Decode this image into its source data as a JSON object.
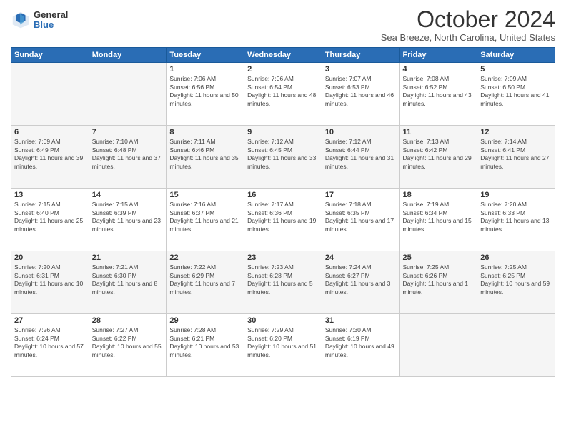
{
  "logo": {
    "general": "General",
    "blue": "Blue"
  },
  "title": "October 2024",
  "subtitle": "Sea Breeze, North Carolina, United States",
  "days_of_week": [
    "Sunday",
    "Monday",
    "Tuesday",
    "Wednesday",
    "Thursday",
    "Friday",
    "Saturday"
  ],
  "weeks": [
    [
      {
        "day": "",
        "empty": true
      },
      {
        "day": "",
        "empty": true
      },
      {
        "day": "1",
        "sunrise": "Sunrise: 7:06 AM",
        "sunset": "Sunset: 6:56 PM",
        "daylight": "Daylight: 11 hours and 50 minutes."
      },
      {
        "day": "2",
        "sunrise": "Sunrise: 7:06 AM",
        "sunset": "Sunset: 6:54 PM",
        "daylight": "Daylight: 11 hours and 48 minutes."
      },
      {
        "day": "3",
        "sunrise": "Sunrise: 7:07 AM",
        "sunset": "Sunset: 6:53 PM",
        "daylight": "Daylight: 11 hours and 46 minutes."
      },
      {
        "day": "4",
        "sunrise": "Sunrise: 7:08 AM",
        "sunset": "Sunset: 6:52 PM",
        "daylight": "Daylight: 11 hours and 43 minutes."
      },
      {
        "day": "5",
        "sunrise": "Sunrise: 7:09 AM",
        "sunset": "Sunset: 6:50 PM",
        "daylight": "Daylight: 11 hours and 41 minutes."
      }
    ],
    [
      {
        "day": "6",
        "sunrise": "Sunrise: 7:09 AM",
        "sunset": "Sunset: 6:49 PM",
        "daylight": "Daylight: 11 hours and 39 minutes."
      },
      {
        "day": "7",
        "sunrise": "Sunrise: 7:10 AM",
        "sunset": "Sunset: 6:48 PM",
        "daylight": "Daylight: 11 hours and 37 minutes."
      },
      {
        "day": "8",
        "sunrise": "Sunrise: 7:11 AM",
        "sunset": "Sunset: 6:46 PM",
        "daylight": "Daylight: 11 hours and 35 minutes."
      },
      {
        "day": "9",
        "sunrise": "Sunrise: 7:12 AM",
        "sunset": "Sunset: 6:45 PM",
        "daylight": "Daylight: 11 hours and 33 minutes."
      },
      {
        "day": "10",
        "sunrise": "Sunrise: 7:12 AM",
        "sunset": "Sunset: 6:44 PM",
        "daylight": "Daylight: 11 hours and 31 minutes."
      },
      {
        "day": "11",
        "sunrise": "Sunrise: 7:13 AM",
        "sunset": "Sunset: 6:42 PM",
        "daylight": "Daylight: 11 hours and 29 minutes."
      },
      {
        "day": "12",
        "sunrise": "Sunrise: 7:14 AM",
        "sunset": "Sunset: 6:41 PM",
        "daylight": "Daylight: 11 hours and 27 minutes."
      }
    ],
    [
      {
        "day": "13",
        "sunrise": "Sunrise: 7:15 AM",
        "sunset": "Sunset: 6:40 PM",
        "daylight": "Daylight: 11 hours and 25 minutes."
      },
      {
        "day": "14",
        "sunrise": "Sunrise: 7:15 AM",
        "sunset": "Sunset: 6:39 PM",
        "daylight": "Daylight: 11 hours and 23 minutes."
      },
      {
        "day": "15",
        "sunrise": "Sunrise: 7:16 AM",
        "sunset": "Sunset: 6:37 PM",
        "daylight": "Daylight: 11 hours and 21 minutes."
      },
      {
        "day": "16",
        "sunrise": "Sunrise: 7:17 AM",
        "sunset": "Sunset: 6:36 PM",
        "daylight": "Daylight: 11 hours and 19 minutes."
      },
      {
        "day": "17",
        "sunrise": "Sunrise: 7:18 AM",
        "sunset": "Sunset: 6:35 PM",
        "daylight": "Daylight: 11 hours and 17 minutes."
      },
      {
        "day": "18",
        "sunrise": "Sunrise: 7:19 AM",
        "sunset": "Sunset: 6:34 PM",
        "daylight": "Daylight: 11 hours and 15 minutes."
      },
      {
        "day": "19",
        "sunrise": "Sunrise: 7:20 AM",
        "sunset": "Sunset: 6:33 PM",
        "daylight": "Daylight: 11 hours and 13 minutes."
      }
    ],
    [
      {
        "day": "20",
        "sunrise": "Sunrise: 7:20 AM",
        "sunset": "Sunset: 6:31 PM",
        "daylight": "Daylight: 11 hours and 10 minutes."
      },
      {
        "day": "21",
        "sunrise": "Sunrise: 7:21 AM",
        "sunset": "Sunset: 6:30 PM",
        "daylight": "Daylight: 11 hours and 8 minutes."
      },
      {
        "day": "22",
        "sunrise": "Sunrise: 7:22 AM",
        "sunset": "Sunset: 6:29 PM",
        "daylight": "Daylight: 11 hours and 7 minutes."
      },
      {
        "day": "23",
        "sunrise": "Sunrise: 7:23 AM",
        "sunset": "Sunset: 6:28 PM",
        "daylight": "Daylight: 11 hours and 5 minutes."
      },
      {
        "day": "24",
        "sunrise": "Sunrise: 7:24 AM",
        "sunset": "Sunset: 6:27 PM",
        "daylight": "Daylight: 11 hours and 3 minutes."
      },
      {
        "day": "25",
        "sunrise": "Sunrise: 7:25 AM",
        "sunset": "Sunset: 6:26 PM",
        "daylight": "Daylight: 11 hours and 1 minute."
      },
      {
        "day": "26",
        "sunrise": "Sunrise: 7:25 AM",
        "sunset": "Sunset: 6:25 PM",
        "daylight": "Daylight: 10 hours and 59 minutes."
      }
    ],
    [
      {
        "day": "27",
        "sunrise": "Sunrise: 7:26 AM",
        "sunset": "Sunset: 6:24 PM",
        "daylight": "Daylight: 10 hours and 57 minutes."
      },
      {
        "day": "28",
        "sunrise": "Sunrise: 7:27 AM",
        "sunset": "Sunset: 6:22 PM",
        "daylight": "Daylight: 10 hours and 55 minutes."
      },
      {
        "day": "29",
        "sunrise": "Sunrise: 7:28 AM",
        "sunset": "Sunset: 6:21 PM",
        "daylight": "Daylight: 10 hours and 53 minutes."
      },
      {
        "day": "30",
        "sunrise": "Sunrise: 7:29 AM",
        "sunset": "Sunset: 6:20 PM",
        "daylight": "Daylight: 10 hours and 51 minutes."
      },
      {
        "day": "31",
        "sunrise": "Sunrise: 7:30 AM",
        "sunset": "Sunset: 6:19 PM",
        "daylight": "Daylight: 10 hours and 49 minutes."
      },
      {
        "day": "",
        "empty": true
      },
      {
        "day": "",
        "empty": true
      }
    ]
  ]
}
